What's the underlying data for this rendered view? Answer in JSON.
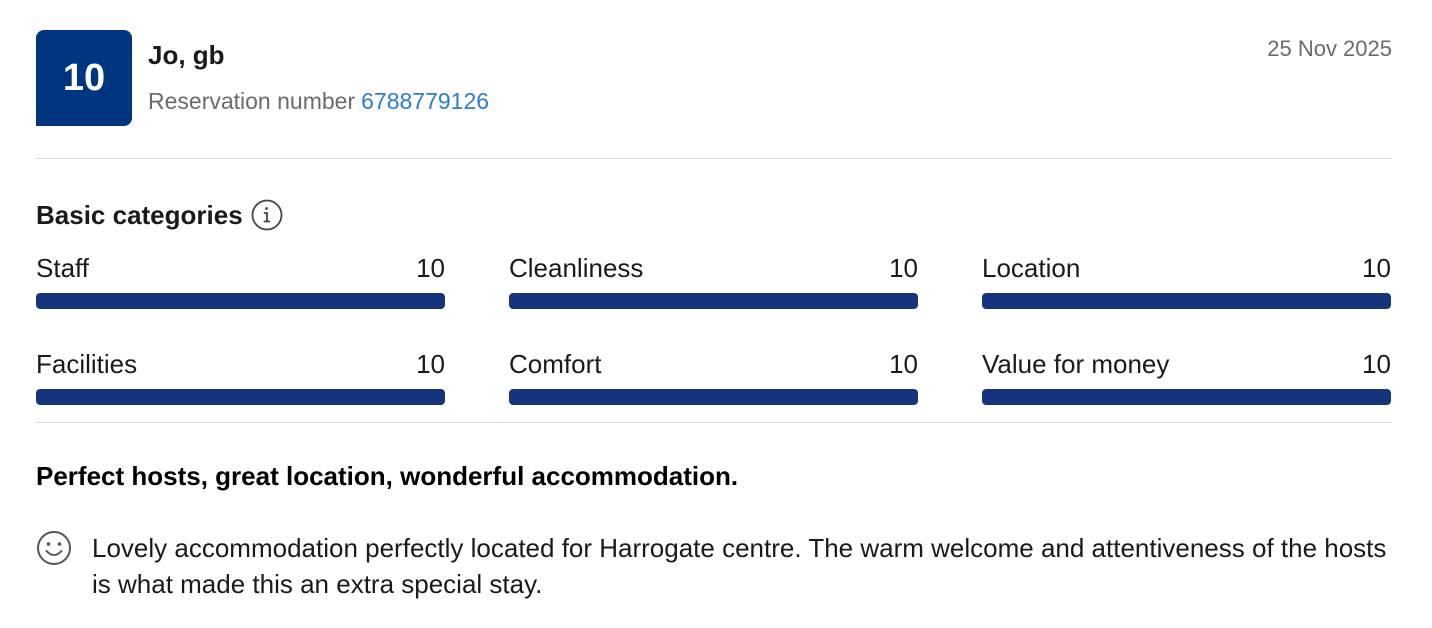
{
  "review": {
    "score": "10",
    "reviewer": "Jo, gb",
    "reservation_label": "Reservation number",
    "reservation_number": "6788779126",
    "date": "25 Nov 2025",
    "categories_title": "Basic categories",
    "categories": [
      {
        "label": "Staff",
        "score": "10",
        "fill": 1.0
      },
      {
        "label": "Cleanliness",
        "score": "10",
        "fill": 1.0
      },
      {
        "label": "Location",
        "score": "10",
        "fill": 1.0
      },
      {
        "label": "Facilities",
        "score": "10",
        "fill": 1.0
      },
      {
        "label": "Comfort",
        "score": "10",
        "fill": 1.0
      },
      {
        "label": "Value for money",
        "score": "10",
        "fill": 1.0
      }
    ],
    "headline": "Perfect hosts, great location, wonderful accommodation.",
    "positive_text": "Lovely accommodation perfectly located for Harrogate centre. The warm welcome and attentiveness of the hosts is what made this an extra special stay."
  },
  "icons": {
    "info": "info-icon",
    "positive": "smiley-face-icon"
  },
  "colors": {
    "brand": "#003580",
    "bar": "#16347d",
    "link": "#2e7bcf",
    "muted": "#6b6b6b"
  }
}
